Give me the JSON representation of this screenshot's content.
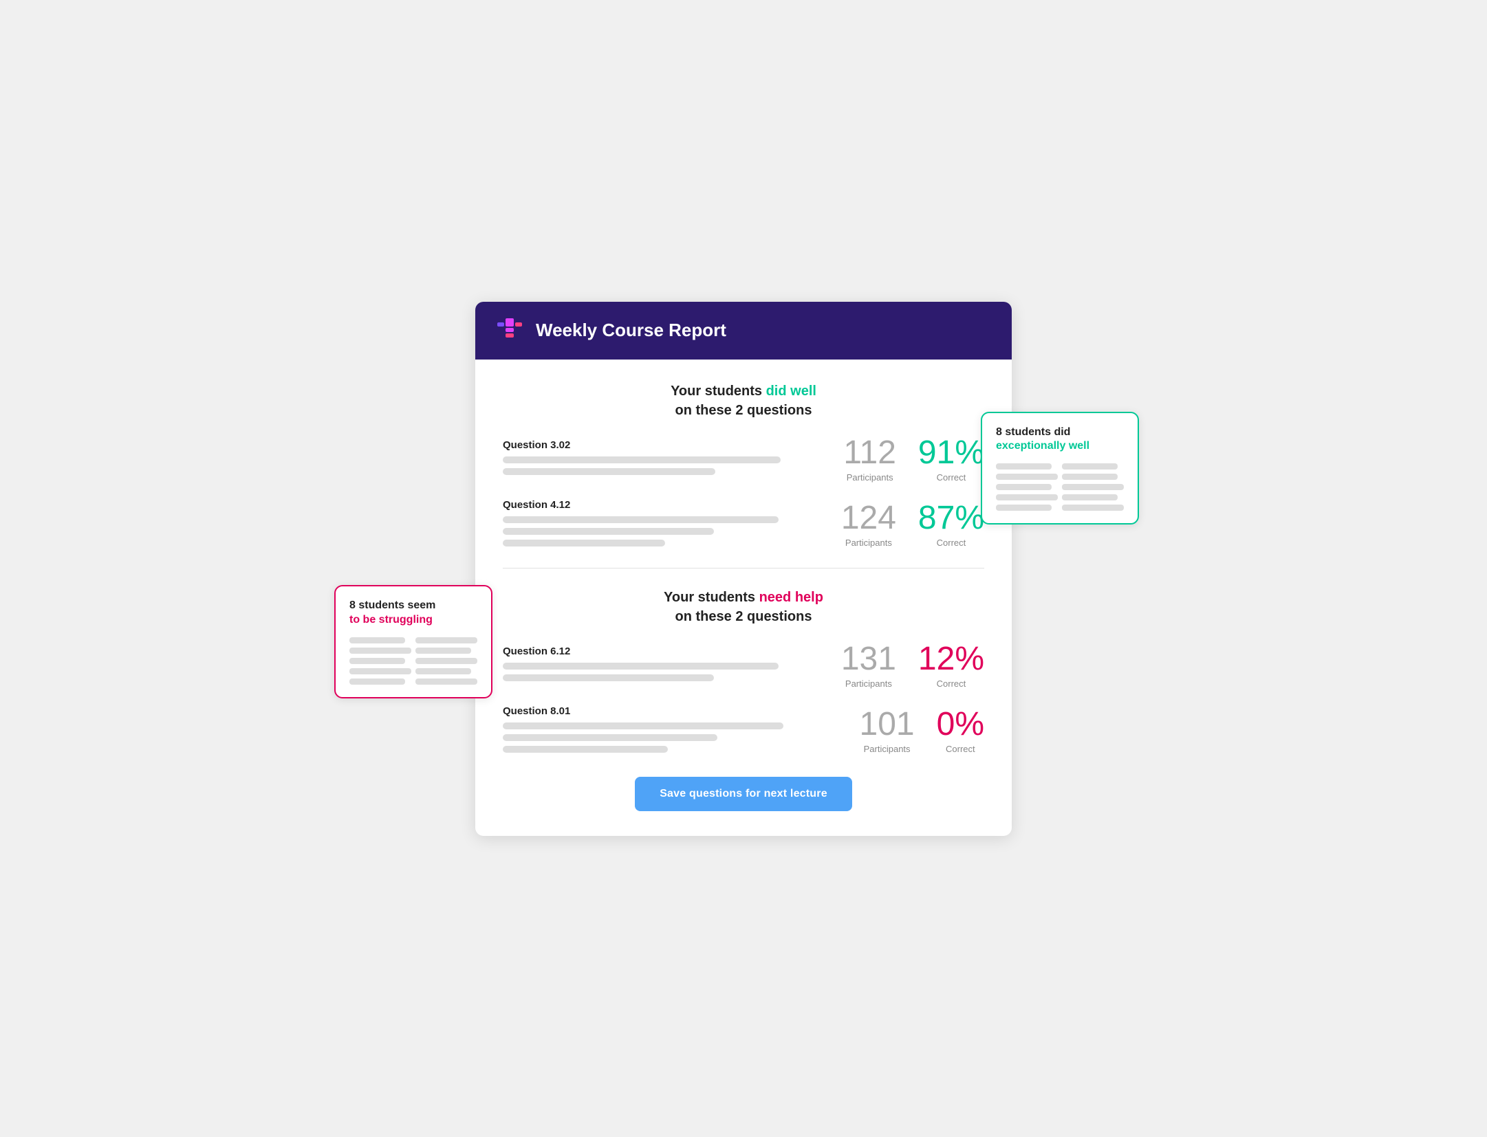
{
  "header": {
    "title": "Weekly Course Report"
  },
  "did_well_section": {
    "title_part1": "Your students ",
    "title_highlight": "did well",
    "title_part2": "on these 2 questions",
    "highlight_color": "green",
    "questions": [
      {
        "label": "Question 3.02",
        "participants": "112",
        "correct": "91%",
        "participants_label": "Participants",
        "correct_label": "Correct"
      },
      {
        "label": "Question 4.12",
        "participants": "124",
        "correct": "87%",
        "participants_label": "Participants",
        "correct_label": "Correct"
      }
    ]
  },
  "need_help_section": {
    "title_part1": "Your students ",
    "title_highlight": "need help",
    "title_part2": "on these 2 questions",
    "highlight_color": "pink",
    "questions": [
      {
        "label": "Question 6.12",
        "participants": "131",
        "correct": "12%",
        "participants_label": "Participants",
        "correct_label": "Correct"
      },
      {
        "label": "Question 8.01",
        "participants": "101",
        "correct": "0%",
        "participants_label": "Participants",
        "correct_label": "Correct"
      }
    ]
  },
  "save_button": {
    "label": "Save questions for next lecture"
  },
  "callout_well": {
    "prefix": "8 students did",
    "highlight": "exceptionally well",
    "highlight_color": "green"
  },
  "callout_struggling": {
    "prefix": "8 students ",
    "part2": "seem",
    "part3": "to be struggling",
    "highlight_color": "pink"
  }
}
